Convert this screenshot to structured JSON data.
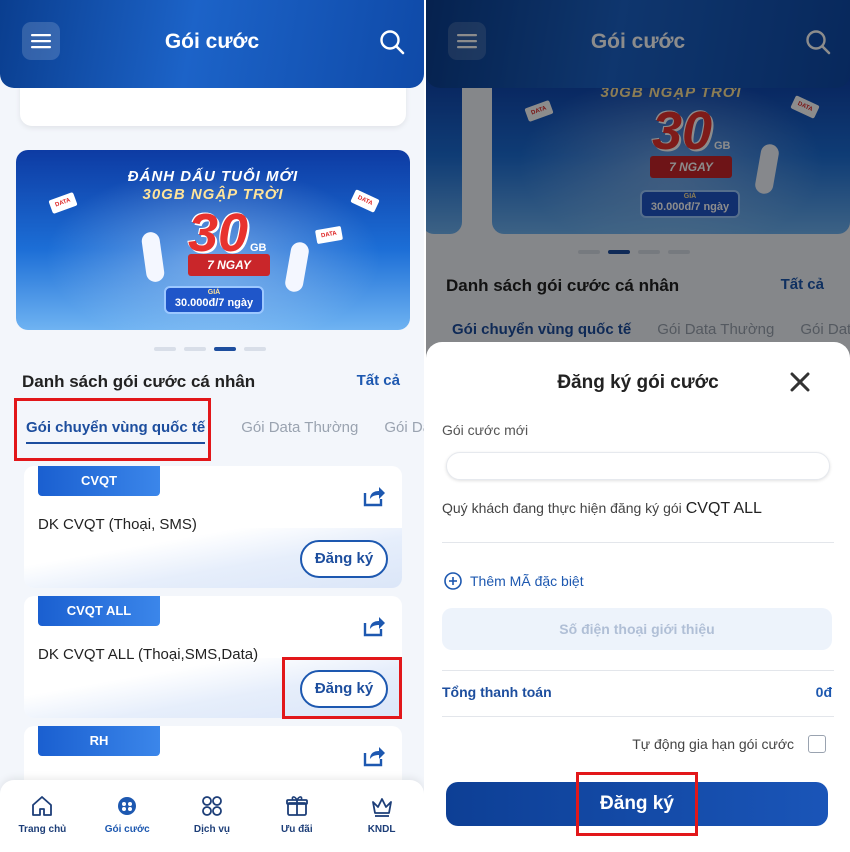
{
  "left": {
    "header": {
      "title": "Gói cước"
    },
    "banner": {
      "line1": "ĐÁNH DẤU TUỔI MỚI",
      "line2": "30GB NGẬP TRỜI",
      "big_number": "30",
      "unit": "GB",
      "duration": "7 NGAY",
      "price_label": "GIÁ",
      "price": "30.000đ/7 ngày",
      "ticket": "DATA",
      "slide_count": 4,
      "active_slide": 3
    },
    "section": {
      "title": "Danh sách gói cước cá nhân",
      "see_all": "Tất cả"
    },
    "tabs": [
      {
        "label": "Gói chuyển vùng quốc tế",
        "active": true
      },
      {
        "label": "Gói Data Thường",
        "active": false
      },
      {
        "label": "Gói Data",
        "active": false
      }
    ],
    "packages": [
      {
        "badge": "CVQT",
        "name": "DK CVQT (Thoại, SMS)",
        "button": "Đăng ký"
      },
      {
        "badge": "CVQT ALL",
        "name": "DK CVQT ALL (Thoại,SMS,Data)",
        "button": "Đăng ký"
      },
      {
        "badge": "RH",
        "name": "",
        "button": ""
      }
    ],
    "bottom_nav": [
      {
        "label": "Trang chủ",
        "icon": "home-icon",
        "active": false
      },
      {
        "label": "Gói cước",
        "icon": "package-icon",
        "active": true
      },
      {
        "label": "Dịch vụ",
        "icon": "grid-icon",
        "active": false
      },
      {
        "label": "Ưu đãi",
        "icon": "gift-icon",
        "active": false
      },
      {
        "label": "KNDL",
        "icon": "crown-icon",
        "active": false
      }
    ]
  },
  "right": {
    "header": {
      "title": "Gói cước"
    },
    "banner": {
      "line2": "30GB NGẬP TRỜI",
      "big_number": "30",
      "unit": "GB",
      "duration": "7 NGAY",
      "price_label": "GIÁ",
      "price": "30.000đ/7 ngày",
      "ticket": "DATA"
    },
    "section": {
      "title": "Danh sách gói cước cá nhân",
      "see_all": "Tất cả"
    },
    "tabs": [
      {
        "label": "Gói chuyển vùng quốc tế",
        "active": true
      },
      {
        "label": "Gói Data Thường",
        "active": false
      },
      {
        "label": "Gói Data",
        "active": false
      }
    ],
    "modal": {
      "title": "Đăng ký gói cước",
      "field_label": "Gói cước mới",
      "field_value": "",
      "info_prefix": "Quý khách đang thực hiện đăng ký gói",
      "info_package": "CVQT ALL",
      "add_code": "Thêm MÃ đặc biệt",
      "referral_placeholder": "Số điện thoại giới thiệu",
      "total_label": "Tổng thanh toán",
      "total_value": "0đ",
      "auto_renew": "Tự động gia hạn gói cước",
      "auto_renew_checked": false,
      "submit": "Đăng ký"
    }
  },
  "colors": {
    "brand": "#1d4e9e",
    "accent": "#1d58b0",
    "highlight": "#e2171a"
  }
}
